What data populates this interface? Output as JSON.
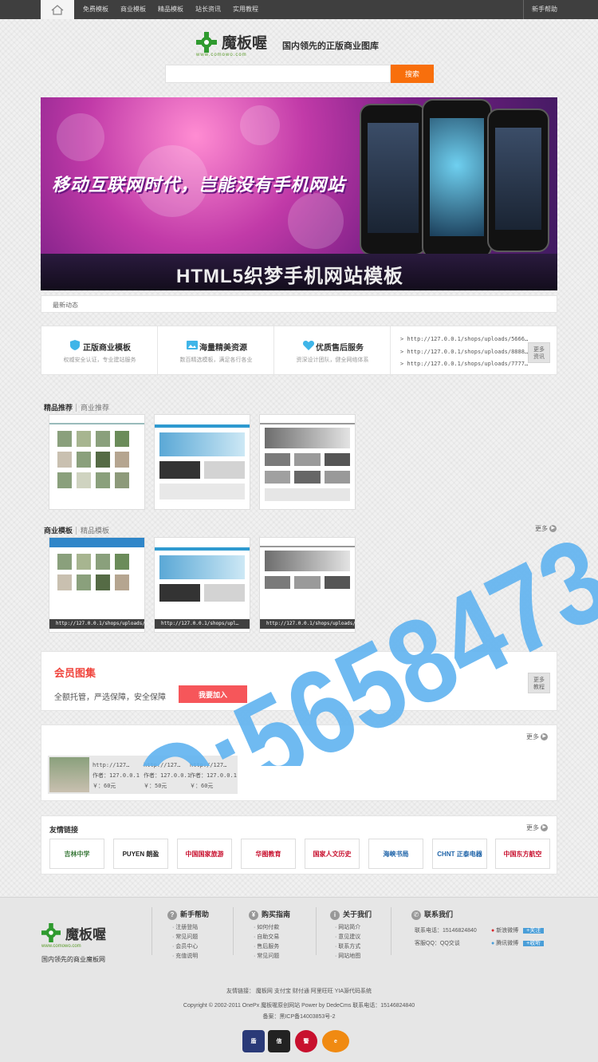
{
  "topbar": {
    "nav": [
      "免费模板",
      "商业模板",
      "精品模板",
      "站长资讯",
      "实用教程"
    ],
    "help": "新手帮助"
  },
  "header": {
    "brand": "魔板喔",
    "url": "www.comowo.com",
    "slogan": "国内领先的正版商业图库",
    "search_button": "搜索",
    "search_value": ""
  },
  "banner": {
    "headline": "移动互联网时代，岂能没有手机网站",
    "subhead": "HTML5织梦手机网站模板"
  },
  "news": {
    "label": "最新动态"
  },
  "features": [
    {
      "title": "正版商业模板",
      "desc": "权威安全认证，专业建站服务",
      "icon": "shield-icon",
      "color": "#3fb5e8"
    },
    {
      "title": "海量精美资源",
      "desc": "数百精选模板，满足各行各业",
      "icon": "image-icon",
      "color": "#3fb5e8"
    },
    {
      "title": "优质售后服务",
      "desc": "资深设计团队，健全网络体系",
      "icon": "heart-icon",
      "color": "#3fb5e8"
    }
  ],
  "feature_links": [
    "http://127.0.0.1/shops/uploads/5666…",
    "http://127.0.0.1/shops/uploads/8888…",
    "http://127.0.0.1/shops/uploads/7777…"
  ],
  "feature_more": "更多\n资讯",
  "section1": {
    "title": "精品推荐",
    "sub": "商业推荐"
  },
  "section2": {
    "title": "商业模板",
    "sub": "精品模板",
    "more": "更多"
  },
  "section2_captions": [
    "http://127.0.0.1/shops/uploads/…",
    "http://127.0.0.1/shops/upl…",
    "http://127.0.0.1/shops/uploads/…"
  ],
  "member": {
    "title": "会员图集",
    "desc": "全额托管，严选保障，安全保障",
    "button": "我要加入",
    "more": "更多\n教程"
  },
  "picset": {
    "more": "更多",
    "items": [
      {
        "url": "http://127…",
        "author": "作者：127.0.0.1",
        "price": "￥：60元"
      },
      {
        "url": "http://127…",
        "author": "作者：127.0.0.1",
        "price": "￥：50元"
      },
      {
        "url": "http://127…",
        "author": "作者：127.0.0.1",
        "price": "￥：60元"
      }
    ]
  },
  "friends": {
    "title": "友情链接",
    "more": "更多",
    "logos": [
      "吉林中学",
      "PUYEN 朗盈",
      "中国国家旅游",
      "华图教育",
      "国家人文历史",
      "海峡书局",
      "CHNT 正泰电器",
      "中国东方航空"
    ]
  },
  "footer": {
    "brand": "魔板喔",
    "url": "www.comowo.com",
    "tagline": "国内领先的商业魔板网",
    "cols": [
      {
        "title": "新手帮助",
        "items": [
          "注册登陆",
          "常见问题",
          "会员中心",
          "充值说明"
        ]
      },
      {
        "title": "购买指南",
        "items": [
          "如何付款",
          "自助交易",
          "售后服务",
          "常见问题"
        ]
      },
      {
        "title": "关于我们",
        "items": [
          "网站简介",
          "意见建议",
          "联系方式",
          "网站地图"
        ]
      }
    ],
    "contact_title": "联系我们",
    "phone": "联系电话：15146824840",
    "qq": "客服QQ：QQ交谈",
    "weibo1": "新浪微博",
    "weibo2": "腾讯微博",
    "follow": "+关注",
    "listen": "+收听",
    "links": "友情链接：  魔板网   支付宝   财付通   阿里旺旺   YIA源代码系统",
    "copyright": "Copyright © 2002-2011 OnePx 魔板喔原创网站 Power by DedeCms 联系电话：15146824840",
    "icp": "备案：黑ICP备14003853号-2"
  },
  "watermark": "QQ:5658473"
}
